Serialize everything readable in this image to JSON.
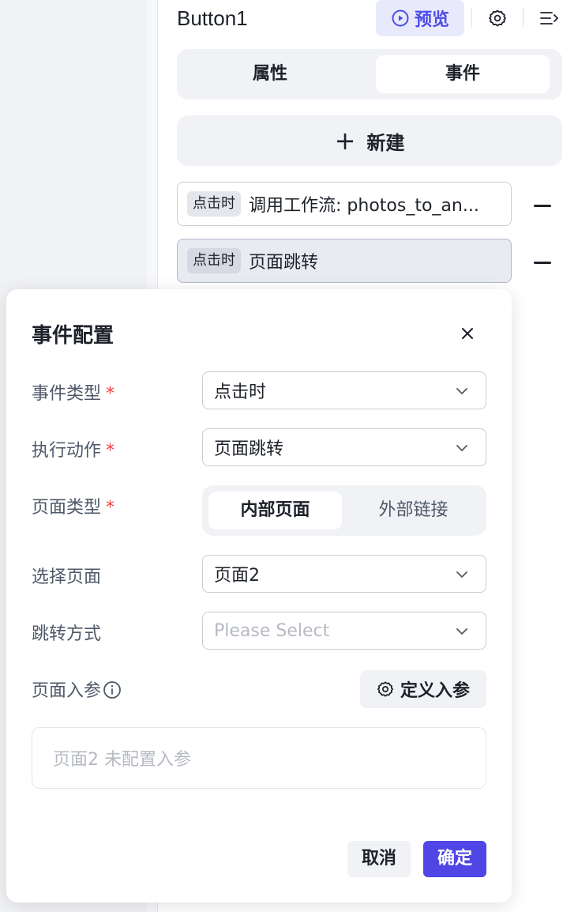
{
  "header": {
    "component_name": "Button1",
    "preview_label": "预览",
    "icons": [
      "play-circle-icon",
      "gear-icon",
      "collapse-panel-icon"
    ],
    "accent_color": "#4c4ce8"
  },
  "tabs": {
    "items": [
      {
        "label": "属性",
        "active": false
      },
      {
        "label": "事件",
        "active": true
      }
    ]
  },
  "new_button": {
    "icon": "+",
    "label": "新建"
  },
  "events": [
    {
      "trigger": "点击时",
      "description": "调用工作流: photos_to_an...",
      "selected": false,
      "remove_icon": "minus-icon"
    },
    {
      "trigger": "点击时",
      "description": "页面跳转",
      "selected": true,
      "remove_icon": "minus-icon"
    }
  ],
  "dialog": {
    "title": "事件配置",
    "close_icon": "close-icon",
    "required_mark": "*",
    "fields": {
      "event_type": {
        "label": "事件类型",
        "required": true,
        "value": "点击时"
      },
      "action": {
        "label": "执行动作",
        "required": true,
        "value": "页面跳转"
      },
      "page_type": {
        "label": "页面类型",
        "required": true,
        "options": [
          "内部页面",
          "外部链接"
        ],
        "selected": "内部页面"
      },
      "page": {
        "label": "选择页面",
        "required": false,
        "value": "页面2"
      },
      "jump_mode": {
        "label": "跳转方式",
        "required": false,
        "value": "",
        "placeholder": "Please Select"
      },
      "page_params": {
        "label": "页面入参",
        "info_icon": "info-icon",
        "define_button": "定义入参",
        "empty_text": "页面2 未配置入参"
      }
    },
    "cancel_label": "取消",
    "confirm_label": "确定",
    "confirm_color": "#4f46e5",
    "required_color": "#f53f3f"
  }
}
